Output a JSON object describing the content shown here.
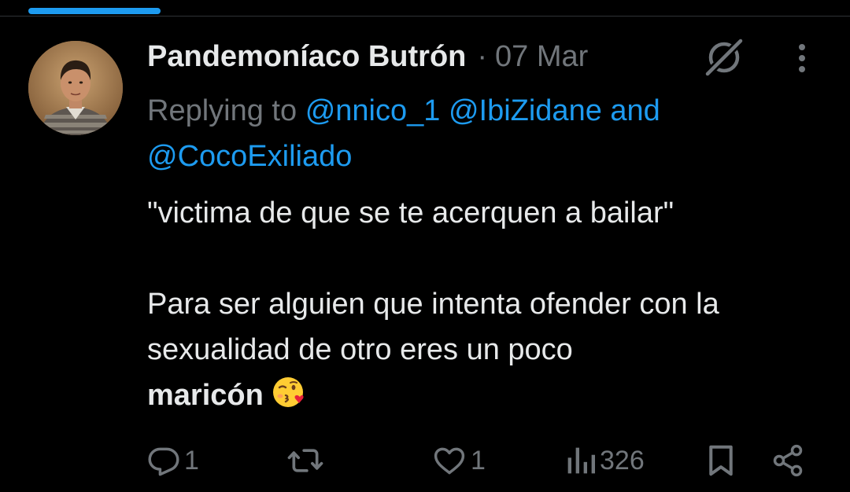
{
  "tweet": {
    "author": {
      "display_name": "Pandemoníaco Butrón",
      "avatar_icon": "person-photo"
    },
    "date": "07 Mar",
    "separator": "·",
    "reply": {
      "prefix": "Replying to",
      "mention_1": "@nnico_1",
      "mention_2": "@IbiZidane",
      "conjunction": "and",
      "mention_3": "@CocoExiliado"
    },
    "text": {
      "line_1": "\"victima de que se te acerquen a bailar\"",
      "line_2": "Para ser alguien que intenta ofender con la sexualidad de otro eres un poco",
      "line_3_bold": "maricón",
      "emoji": "face-blowing-a-kiss"
    },
    "actions": {
      "replies": "1",
      "retweets": "",
      "likes": "1",
      "views": "326"
    }
  },
  "colors": {
    "background": "#000000",
    "primary_text": "#e7e9ea",
    "secondary_text": "#71767b",
    "accent": "#1d9bf0"
  },
  "icons": {
    "grok": "grok-icon",
    "more": "more-vertical-icon",
    "reply": "reply-icon",
    "retweet": "retweet-icon",
    "like": "heart-icon",
    "views": "views-icon",
    "bookmark": "bookmark-icon",
    "share": "share-icon"
  }
}
